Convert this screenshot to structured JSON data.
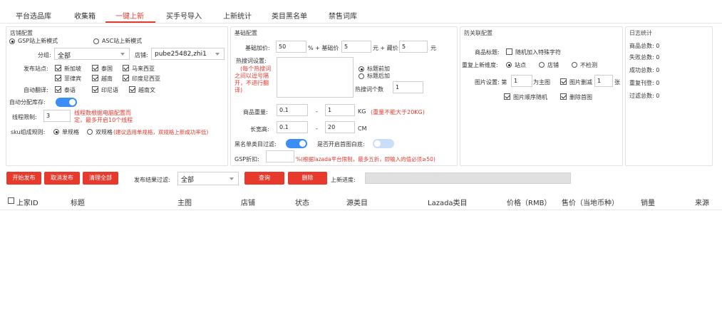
{
  "tabs": [
    {
      "label": "平台选品库"
    },
    {
      "label": "收集箱"
    },
    {
      "label": "一键上新"
    },
    {
      "label": "买手号导入"
    },
    {
      "label": "上新统计"
    },
    {
      "label": "类目黑名单"
    },
    {
      "label": "禁售词库"
    }
  ],
  "store": {
    "title": "店铺配置",
    "mode_gsp": "GSP站上新模式",
    "mode_asc": "ASC站上新模式",
    "group_label": "分组:",
    "group_value": "全部",
    "shop_label": "店铺:",
    "shop_value": "pube25482,zhi1",
    "sites_label": "发布站点:",
    "sites": [
      "新加坡",
      "泰国",
      "马来西亚",
      "菲律宾",
      "越南",
      "印度尼西亚"
    ],
    "translate_label": "自动翻译:",
    "translate": [
      "泰语",
      "印尼语",
      "越南文"
    ],
    "auto_stock_label": "自动分配库存:",
    "thread_label": "线程限制:",
    "thread_value": "3",
    "thread_note_1": "线程数根据电脑配置而",
    "thread_note_2": "定，最多开启10个线程",
    "sku_label": "sku组成规则:",
    "sku_single": "单规格",
    "sku_double": "双规格",
    "sku_note": "(建议选用单规格，双规格上新成功率低)"
  },
  "basic": {
    "title": "基础配置",
    "markup_label": "基础加价:",
    "markup_value": "50",
    "plus_base_label": "% + 基础价",
    "base_value": "5",
    "yuan_plus_profit": "元 + 藏价",
    "profit_value": "5",
    "yuan": "元",
    "hot_label": "热搜词设置:",
    "hot_note_1": "(每个热搜词",
    "hot_note_2": "之间以逗号隔",
    "hot_note_3": "开，不进行翻",
    "hot_note_4": "译)",
    "before_title": "标题前加",
    "after_title": "标题后加",
    "hot_count_label": "热搜词个数",
    "hot_count_value": "1",
    "weight_label": "商品重量:",
    "weight_min": "0.1",
    "dash": "-",
    "weight_max": "1",
    "kg": "KG",
    "weight_note": "(重量不能大于20KG)",
    "size_label": "长宽高:",
    "size_min": "0.1",
    "size_max": "20",
    "cm": "CM",
    "blacklist_label": "黑名单类目过滤:",
    "whitebg_label": "是否开启首图白底:",
    "gsp_discount_label": "GSP折扣:",
    "gsp_discount_value": "",
    "gsp_note": "%(根据lazada平台限制，最多五折，即输入的值必须≥50)"
  },
  "anti": {
    "title": "防关联配置",
    "tag_label": "商品标题:",
    "tag_option": "随机加入特殊字符",
    "dim_label": "重复上新维度:",
    "dim_site": "站点",
    "dim_shop": "店铺",
    "dim_none": "不检测",
    "img_label": "图片设置: 第",
    "img_index": "1",
    "img_main": "为主图",
    "img_delete": "图片删减",
    "img_delete_value": "1",
    "img_unit": "张",
    "img_random": "图片顺序随机",
    "img_delete_first": "删除首图"
  },
  "log": {
    "title": "日志统计",
    "total": "商品总数: 0",
    "fail": "失败总数: 0",
    "success": "成功总数: 0",
    "repeat": "重复刊登: 0",
    "filter": "过滤总数: 0"
  },
  "actions": {
    "start": "开始发布",
    "cancel": "取消发布",
    "clear": "清理全部",
    "filter_label": "发布结果过滤:",
    "filter_value": "全部",
    "query": "查询",
    "delete": "删除",
    "progress_label": "上新进度:",
    "progress": 0
  },
  "table": {
    "headers": [
      "上家ID",
      "标题",
      "主图",
      "店铺",
      "状态",
      "源类目",
      "Lazada类目",
      "价格（RMB）",
      "售价（当地币种）",
      "销量",
      "来源"
    ]
  },
  "colors": {
    "accent": "#e23b30",
    "toggle_on": "#3a8ef6"
  }
}
